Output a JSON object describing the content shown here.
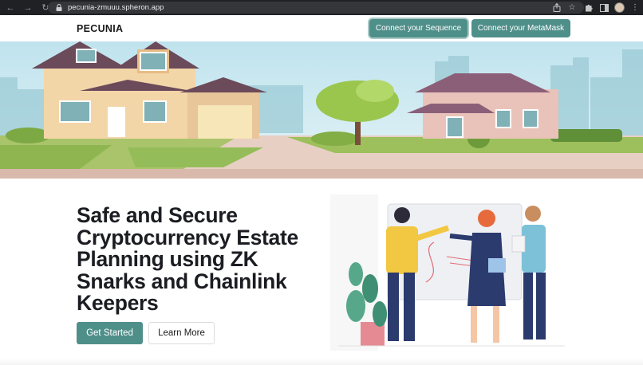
{
  "browser": {
    "url": "pecunia-zmuuu.spheron.app",
    "icons": [
      "back-arrow-icon",
      "forward-arrow-icon",
      "reload-icon",
      "lock-icon",
      "share-icon",
      "bookmark-star-icon",
      "extensions-puzzle-icon",
      "sidebar-icon",
      "profile-avatar",
      "kebab-menu-icon"
    ]
  },
  "header": {
    "brand": "PECUNIA",
    "connect_sequence_label": "Connect your Sequence",
    "connect_metamask_label": "Connect your MetaMask"
  },
  "hero": {
    "headline": "Safe and Secure Cryptocurrency Estate Planning using ZK Snarks and Chainlink Keepers",
    "get_started_label": "Get Started",
    "learn_more_label": "Learn More"
  },
  "colors": {
    "accent": "#4f8f8a",
    "text_dark": "#1c1d22",
    "chrome_bg": "#202124"
  }
}
